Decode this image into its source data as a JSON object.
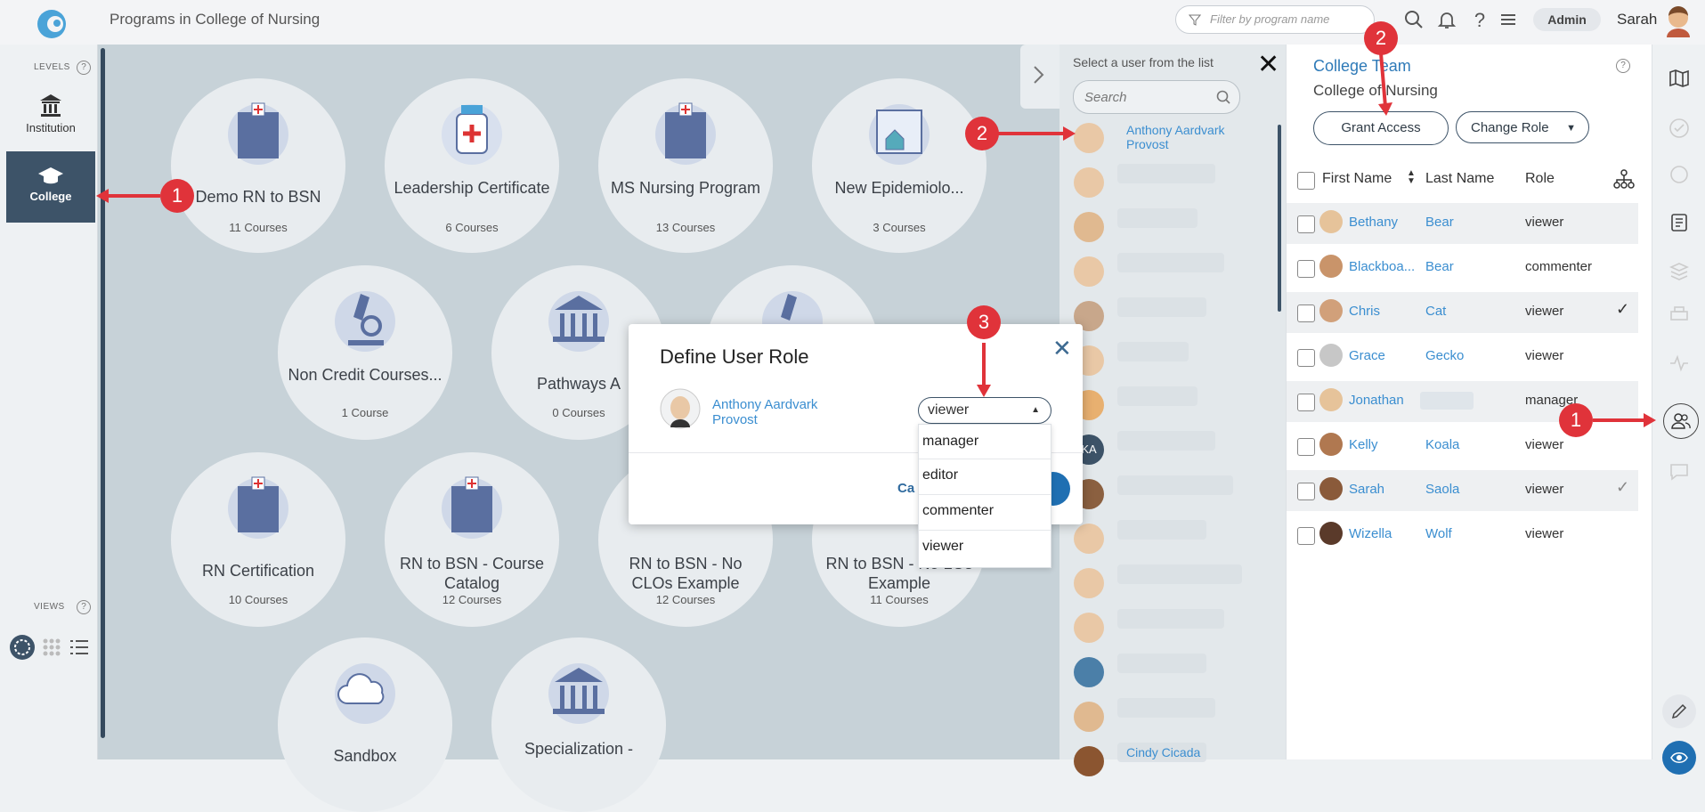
{
  "topbar": {
    "title": "Programs in College of Nursing",
    "filter_placeholder": "Filter by program name",
    "admin_label": "Admin",
    "user_name": "Sarah"
  },
  "left_nav": {
    "levels_label": "LEVELS",
    "views_label": "VIEWS",
    "help": "?",
    "levels": [
      {
        "label": "Institution"
      },
      {
        "label": "College"
      }
    ]
  },
  "programs": [
    {
      "name": "Demo RN to BSN",
      "count": "11 Courses"
    },
    {
      "name": "Leadership Certificate",
      "count": "6 Courses"
    },
    {
      "name": "MS Nursing Program",
      "count": "13 Courses"
    },
    {
      "name": "New Epidemiolo...",
      "count": "3 Courses"
    },
    {
      "name": "Non Credit Courses...",
      "count": "1 Course"
    },
    {
      "name": "Pathways A",
      "count": "0 Courses"
    },
    {
      "name": "RN Certification",
      "count": "10 Courses"
    },
    {
      "name": "RN to BSN - Course Catalog",
      "count": "12 Courses"
    },
    {
      "name": "RN to BSN - No CLOs Example",
      "count": "12 Courses"
    },
    {
      "name": "RN to BSN - No LOs Example",
      "count": "11 Courses"
    },
    {
      "name": "Sandbox",
      "count": ""
    },
    {
      "name": "Specialization -",
      "count": ""
    }
  ],
  "user_list": {
    "header": "Select a user from the list",
    "search_placeholder": "Search",
    "close": "✕",
    "first_user_name": "Anthony Aardvark",
    "first_user_title": "Provost",
    "last_user_name": "Cindy Cicada",
    "initials_badge": "KA"
  },
  "team": {
    "title": "College Team",
    "subtitle": "College of Nursing",
    "grant_access": "Grant Access",
    "change_role": "Change Role",
    "columns": [
      "First Name",
      "Last Name",
      "Role"
    ],
    "rows": [
      {
        "first": "Bethany",
        "last": "Bear",
        "role": "viewer",
        "check": ""
      },
      {
        "first": "Blackboa...",
        "last": "Bear",
        "role": "commenter",
        "check": ""
      },
      {
        "first": "Chris",
        "last": "Cat",
        "role": "viewer",
        "check": "✓"
      },
      {
        "first": "Grace",
        "last": "Gecko",
        "role": "viewer",
        "check": ""
      },
      {
        "first": "Jonathan",
        "last": "",
        "role": "manager",
        "check": ""
      },
      {
        "first": "Kelly",
        "last": "Koala",
        "role": "viewer",
        "check": ""
      },
      {
        "first": "Sarah",
        "last": "Saola",
        "role": "viewer",
        "check": "✓"
      },
      {
        "first": "Wizella",
        "last": "Wolf",
        "role": "viewer",
        "check": ""
      }
    ]
  },
  "modal": {
    "title": "Define User Role",
    "user_name": "Anthony Aardvark",
    "user_title": "Provost",
    "selected_role": "viewer",
    "options": [
      "manager",
      "editor",
      "commenter",
      "viewer"
    ],
    "cancel_partial": "Ca",
    "close": "✕"
  },
  "markers": [
    "1",
    "2",
    "3",
    "2",
    "1"
  ],
  "colors": {
    "accent": "#3b8ed0",
    "marker": "#e0333a",
    "nav_active": "#3d5368"
  }
}
